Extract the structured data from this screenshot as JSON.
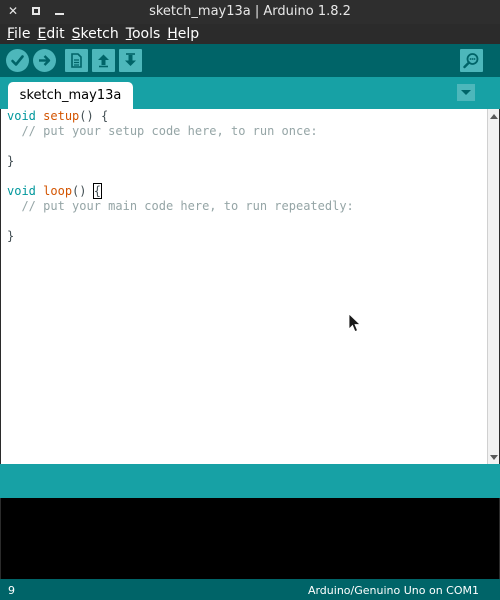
{
  "window": {
    "title": "sketch_may13a | Arduino 1.8.2",
    "close_glyph": "✕"
  },
  "menu": [
    {
      "mnemonic": "F",
      "rest": "ile"
    },
    {
      "mnemonic": "E",
      "rest": "dit"
    },
    {
      "mnemonic": "S",
      "rest": "ketch"
    },
    {
      "mnemonic": "T",
      "rest": "ools"
    },
    {
      "mnemonic": "H",
      "rest": "elp"
    }
  ],
  "toolbar": {
    "icons": [
      "verify-icon",
      "upload-icon",
      "new-icon",
      "open-icon",
      "save-icon",
      "serial-monitor-icon"
    ]
  },
  "tab": {
    "label": "sketch_may13a"
  },
  "code": {
    "line1_type": "void",
    "line1_fn": "setup",
    "line1_rest": "() {",
    "line2_comment": "  // put your setup code here, to run once:",
    "line4": "}",
    "line6_type": "void",
    "line6_fn": "loop",
    "line6_rest": "() ",
    "line6_brace": "{",
    "line7_comment": "  // put your main code here, to run repeatedly:",
    "line9": "}"
  },
  "status": {
    "line_number": "9",
    "board": "Arduino/Genuino Uno on COM1"
  },
  "colors": {
    "toolbar": "#006468",
    "tabstrip": "#17a1a5",
    "button": "#4db7bb",
    "keyword": "#00979c",
    "function": "#d35400",
    "comment": "#95a5a6"
  }
}
